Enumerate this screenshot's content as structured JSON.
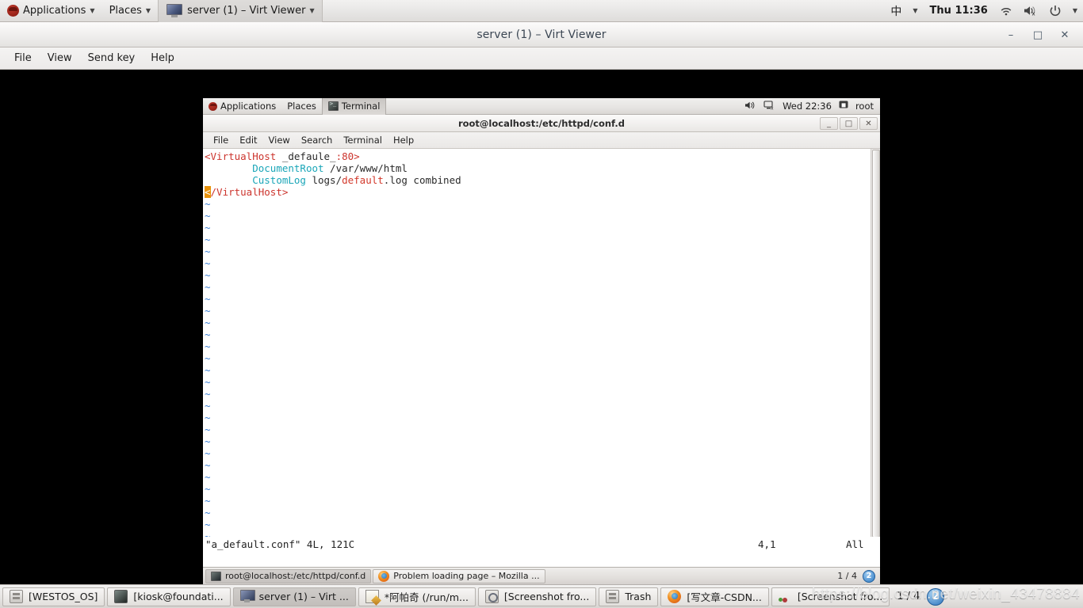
{
  "host_panel": {
    "applications_label": "Applications",
    "places_label": "Places",
    "active_window_label": "server (1) – Virt Viewer",
    "input_method": "中",
    "clock": "Thu 11:36",
    "icons": [
      "redhat-logo",
      "caret-down-icon",
      "caret-down-icon",
      "monitor-icon",
      "caret-down-icon",
      "input-method-icon",
      "caret-down-icon",
      "wifi-icon",
      "volume-muted-icon",
      "power-icon",
      "caret-down-icon"
    ]
  },
  "virt_viewer": {
    "title": "server (1) – Virt Viewer",
    "menu": [
      "File",
      "View",
      "Send key",
      "Help"
    ],
    "window_controls": {
      "minimize": "–",
      "maximize": "□",
      "close": "✕"
    }
  },
  "guest_panel": {
    "applications_label": "Applications",
    "places_label": "Places",
    "active_app_label": "Terminal",
    "clock": "Wed 22:36",
    "user": "root",
    "icons": [
      "redhat-logo",
      "terminal-icon",
      "volume-icon",
      "network-icon",
      "user-icon"
    ]
  },
  "terminal_window": {
    "title": "root@localhost:/etc/httpd/conf.d",
    "menu": [
      "File",
      "Edit",
      "View",
      "Search",
      "Terminal",
      "Help"
    ],
    "window_controls": {
      "minimize": "_",
      "maximize": "□",
      "close": "✕"
    }
  },
  "vim": {
    "lines": [
      [
        {
          "text": "<VirtualHost",
          "class": "c-tag"
        },
        {
          "text": " _defaule_",
          "class": "c-plain"
        },
        {
          "text": ":80>",
          "class": "c-tag"
        }
      ],
      [
        {
          "text": "        ",
          "class": "c-plain"
        },
        {
          "text": "DocumentRoot",
          "class": "c-dir"
        },
        {
          "text": " /var/www/html",
          "class": "c-plain"
        }
      ],
      [
        {
          "text": "        ",
          "class": "c-plain"
        },
        {
          "text": "CustomLog",
          "class": "c-dir"
        },
        {
          "text": " logs/",
          "class": "c-plain"
        },
        {
          "text": "default",
          "class": "c-red"
        },
        {
          "text": ".log combined",
          "class": "c-plain"
        }
      ],
      [
        {
          "text": "<",
          "class": "cursor-blk"
        },
        {
          "text": "/VirtualHost>",
          "class": "c-tag"
        }
      ]
    ],
    "filler_char": "~",
    "filler_count": 33,
    "status_file": "\"a_default.conf\" 4L, 121C",
    "status_position": "4,1",
    "status_scroll": "All"
  },
  "guest_taskbar": {
    "tasks": [
      {
        "label": "root@localhost:/etc/httpd/conf.d",
        "icon": "terminal-icon",
        "focused": true
      },
      {
        "label": "Problem loading page – Mozilla ...",
        "icon": "firefox-icon",
        "focused": false
      }
    ],
    "workspace": "1 / 4",
    "badge": "2"
  },
  "host_taskbar": {
    "tasks": [
      {
        "label": "[WESTOS_OS]",
        "icon": "archive-icon",
        "focused": false
      },
      {
        "label": "[kiosk@foundati...",
        "icon": "terminal-icon",
        "focused": false
      },
      {
        "label": "server (1) – Virt ...",
        "icon": "monitor-icon",
        "focused": true
      },
      {
        "label": "*阿帕奇 (/run/m...",
        "icon": "notepad-icon",
        "focused": false
      },
      {
        "label": "[Screenshot fro...",
        "icon": "screenshot-icon",
        "focused": false
      },
      {
        "label": "Trash",
        "icon": "archive-icon",
        "focused": false
      },
      {
        "label": "[写文章-CSDN...",
        "icon": "firefox-icon",
        "focused": false
      },
      {
        "label": "[Screenshot fro...",
        "icon": "gimp-icon",
        "focused": false
      }
    ],
    "workspace": "1 / 4",
    "badge": "2"
  },
  "watermark": {
    "text": "https://blog.csdn.net/weixin_43478884"
  },
  "colors": {
    "vim_tag": "#cc342d",
    "vim_directive": "#1aa6b8",
    "vim_string": "#d33a2c",
    "vim_tilde": "#3b7fd4",
    "vim_cursor": "#e8920a",
    "panel_bg": "#e8e7e6",
    "terminal_bg": "#ffffff"
  }
}
